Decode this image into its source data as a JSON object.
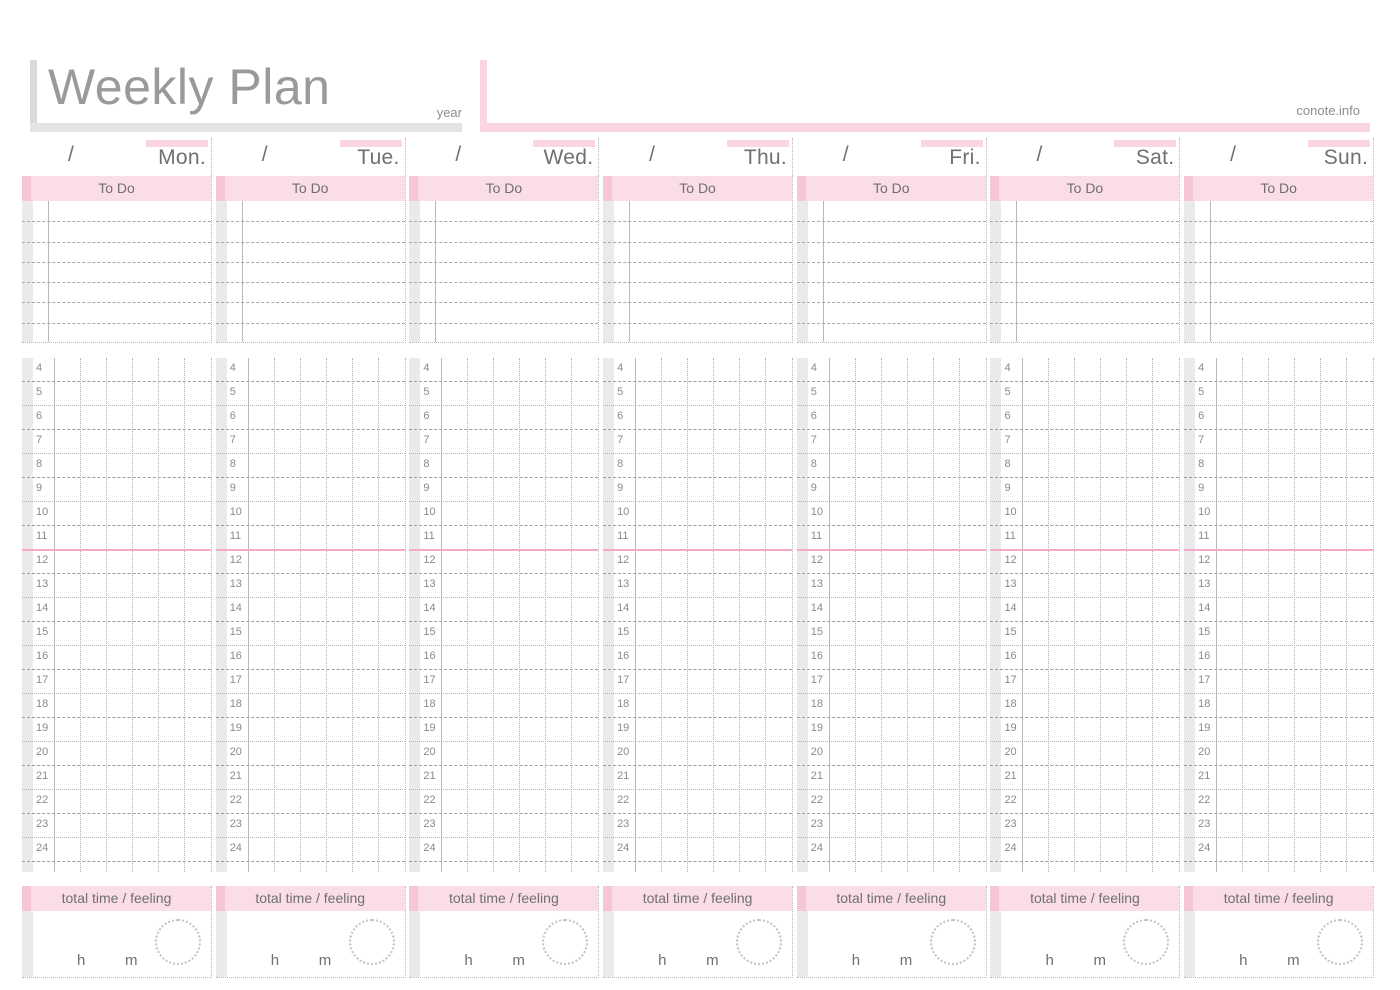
{
  "header": {
    "title": "Weekly Plan",
    "year_label": "year",
    "site": "conote.info",
    "accent_pink": "#fbd5e2",
    "accent_gray": "#d9dadd"
  },
  "labels": {
    "todo": "To Do",
    "total": "total time / feeling",
    "hour_unit": "h",
    "minute_unit": "m",
    "date_slash": "/"
  },
  "hours": [
    4,
    5,
    6,
    7,
    8,
    9,
    10,
    11,
    12,
    13,
    14,
    15,
    16,
    17,
    18,
    19,
    20,
    21,
    22,
    23,
    24
  ],
  "noon_after_hour": 11,
  "todo_line_count": 6,
  "days": [
    {
      "name": "Mon."
    },
    {
      "name": "Tue."
    },
    {
      "name": "Wed."
    },
    {
      "name": "Thu."
    },
    {
      "name": "Fri."
    },
    {
      "name": "Sat."
    },
    {
      "name": "Sun."
    }
  ]
}
